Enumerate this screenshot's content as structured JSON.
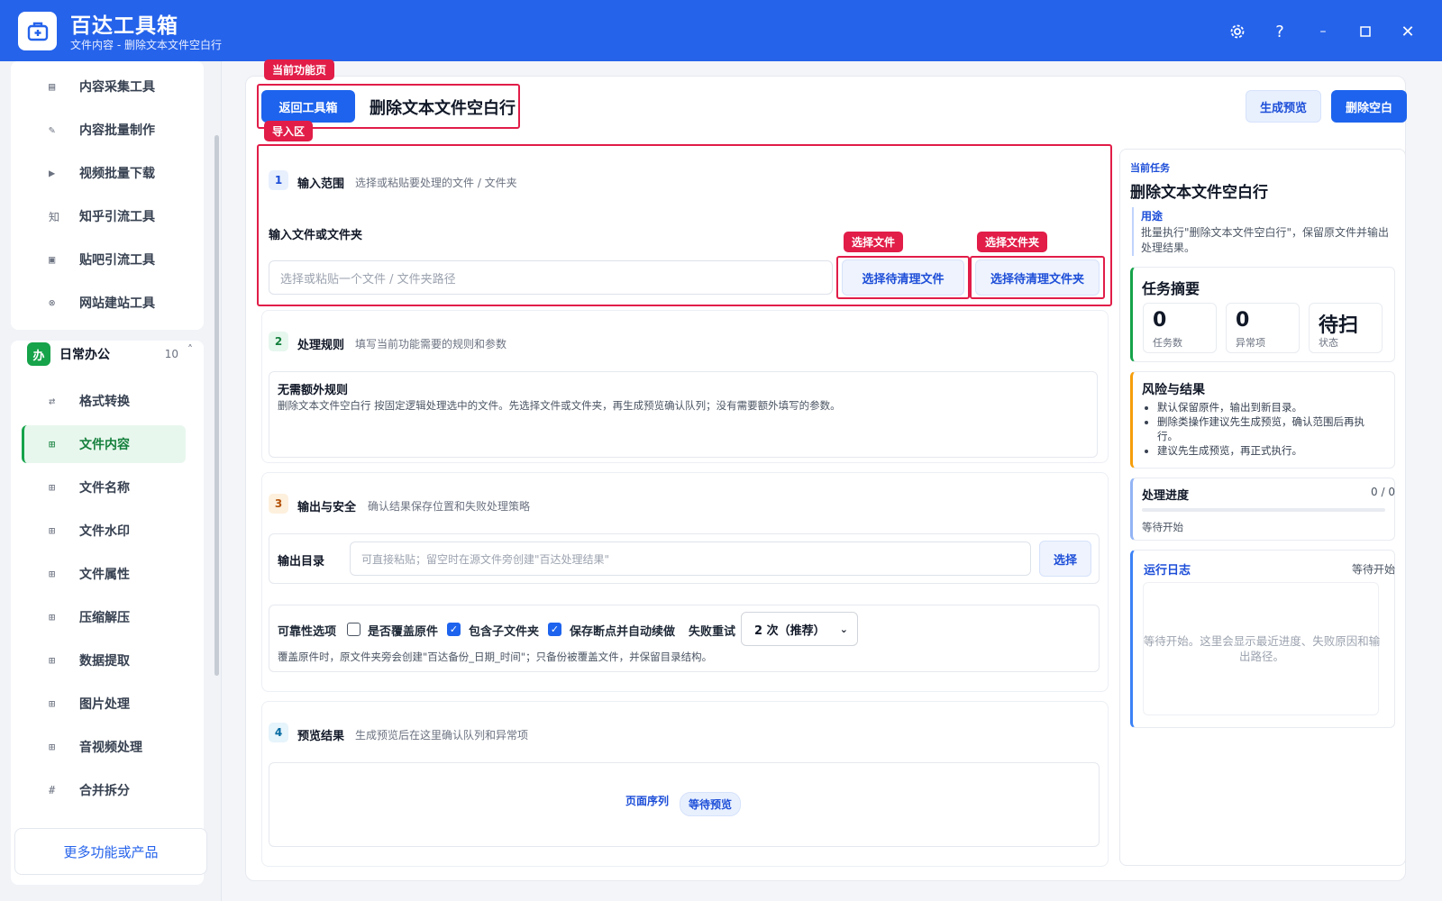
{
  "app": {
    "name": "百达工具箱",
    "subtitle": "文件内容 - 删除文本文件空白行",
    "window_buttons": [
      "gear-icon",
      "help-icon",
      "minimize-icon",
      "maximize-icon",
      "close-icon"
    ]
  },
  "sidebar": {
    "top_items": [
      {
        "label": "内容采集工具",
        "icon": "collect-icon"
      },
      {
        "label": "内容批量制作",
        "icon": "pen-icon"
      },
      {
        "label": "视频批量下载",
        "icon": "video-icon"
      },
      {
        "label": "知乎引流工具",
        "icon": "zhihu-icon"
      },
      {
        "label": "贴吧引流工具",
        "icon": "tieba-icon"
      },
      {
        "label": "网站建站工具",
        "icon": "web-icon"
      }
    ],
    "group": {
      "badge": "办",
      "title": "日常办公",
      "count": "10",
      "caret": "˄"
    },
    "group_items": [
      {
        "label": "格式转换",
        "icon": "swap-icon",
        "glyph": "⇄"
      },
      {
        "label": "文件内容",
        "icon": "grid-icon",
        "glyph": "⊞",
        "active": true
      },
      {
        "label": "文件名称",
        "icon": "grid-icon",
        "glyph": "⊞"
      },
      {
        "label": "文件水印",
        "icon": "grid-icon",
        "glyph": "⊞"
      },
      {
        "label": "文件属性",
        "icon": "grid-icon",
        "glyph": "⊞"
      },
      {
        "label": "压缩解压",
        "icon": "grid-icon",
        "glyph": "⊞"
      },
      {
        "label": "数据提取",
        "icon": "grid-icon",
        "glyph": "⊞"
      },
      {
        "label": "图片处理",
        "icon": "grid-icon",
        "glyph": "⊞"
      },
      {
        "label": "音视频处理",
        "icon": "grid-icon",
        "glyph": "⊞"
      },
      {
        "label": "合并拆分",
        "icon": "hash-icon",
        "glyph": "#"
      }
    ],
    "more_button": "更多功能或产品"
  },
  "annotations": {
    "current_page": "当前功能页",
    "import_area": "导入区",
    "select_file": "选择文件",
    "select_folder": "选择文件夹"
  },
  "header": {
    "back_button": "返回工具箱",
    "title": "删除文本文件空白行",
    "preview_button": "生成预览",
    "run_button": "删除空白"
  },
  "section1": {
    "num": "1",
    "title": "输入范围",
    "desc": "选择或粘贴要处理的文件 / 文件夹",
    "field_label": "输入文件或文件夹",
    "placeholder": "选择或粘贴一个文件 / 文件夹路径",
    "file_button": "选择待清理文件",
    "folder_button": "选择待清理文件夹"
  },
  "section2": {
    "num": "2",
    "title": "处理规则",
    "desc": "填写当前功能需要的规则和参数",
    "rule_title": "无需额外规则",
    "rule_text": "删除文本文件空白行 按固定逻辑处理选中的文件。先选择文件或文件夹，再生成预览确认队列；没有需要额外填写的参数。"
  },
  "section3": {
    "num": "3",
    "title": "输出与安全",
    "desc": "确认结果保存位置和失败处理策略",
    "output_label": "输出目录",
    "output_placeholder": "可直接粘贴；留空时在源文件旁创建\"百达处理结果\"",
    "choose_button": "选择",
    "reliability_label": "可靠性选项",
    "options": [
      {
        "label": "是否覆盖原件",
        "checked": false
      },
      {
        "label": "包含子文件夹",
        "checked": true
      },
      {
        "label": "保存断点并自动续做",
        "checked": true
      }
    ],
    "retry_label": "失败重试",
    "retry_value": "2 次（推荐）",
    "note": "覆盖原件时，原文件夹旁会创建\"百达备份_日期_时间\"；只备份被覆盖文件，并保留目录结构。"
  },
  "section4": {
    "num": "4",
    "title": "预览结果",
    "desc": "生成预览后在这里确认队列和异常项",
    "queue_label": "页面序列",
    "queue_status": "等待预览"
  },
  "right_panel": {
    "task_caption": "当前任务",
    "task_title": "删除文本文件空白行",
    "purpose_label": "用途",
    "purpose_text": "批量执行\"删除文本文件空白行\"，保留原文件并输出处理结果。",
    "summary_title": "任务摘要",
    "stats": [
      {
        "value": "0",
        "label": "任务数"
      },
      {
        "value": "0",
        "label": "异常项"
      },
      {
        "value": "待扫",
        "label": "状态"
      }
    ],
    "risk_title": "风险与结果",
    "risk_items": [
      "默认保留原件，输出到新目录。",
      "删除类操作建议先生成预览，确认范围后再执行。",
      "建议先生成预览，再正式执行。"
    ],
    "progress_title": "处理进度",
    "progress_count": "0 / 0",
    "progress_value": 0,
    "progress_status": "等待开始",
    "log_title": "运行日志",
    "log_status": "等待开始",
    "log_text": "等待开始。这里会显示最近进度、失败原因和输出路径。"
  },
  "colors": {
    "brand": "#2563eb",
    "annotation": "#e11d48",
    "active_green": "#16a34a"
  }
}
